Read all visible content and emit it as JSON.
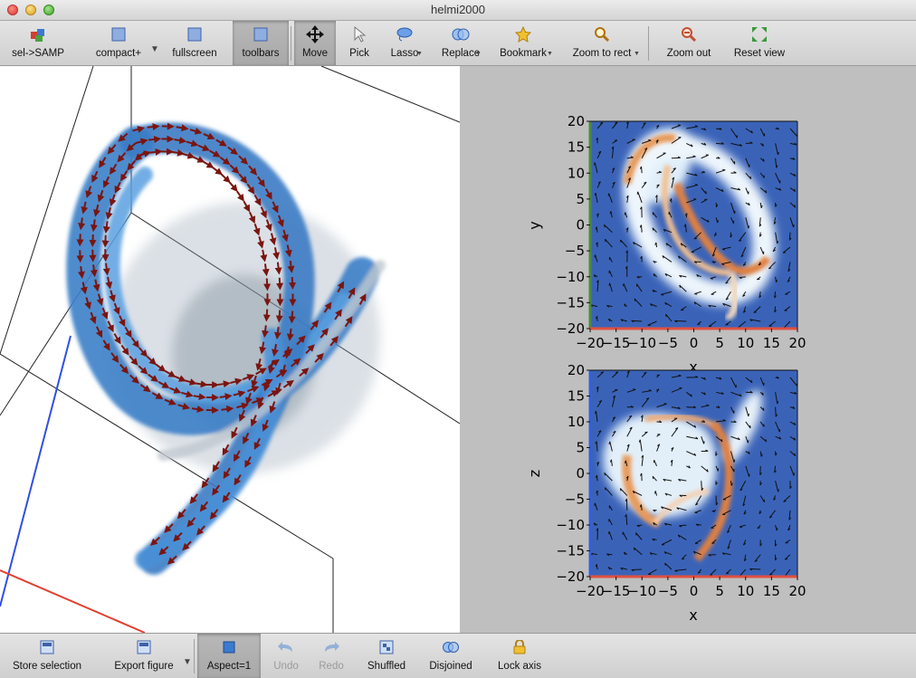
{
  "window": {
    "title": "helmi2000"
  },
  "toolbar": {
    "items": [
      {
        "label": "sel->SAMP"
      },
      {
        "label": "compact+"
      },
      {
        "label": "fullscreen"
      },
      {
        "label": "toolbars"
      },
      {
        "label": "Move"
      },
      {
        "label": "Pick"
      },
      {
        "label": "Lasso"
      },
      {
        "label": "Replace"
      },
      {
        "label": "Bookmark"
      },
      {
        "label": "Zoom to rect"
      },
      {
        "label": "Zoom out"
      },
      {
        "label": "Reset view"
      }
    ]
  },
  "bottombar": {
    "items": [
      {
        "label": "Store selection"
      },
      {
        "label": "Export figure"
      },
      {
        "label": "Aspect=1"
      },
      {
        "label": "Undo"
      },
      {
        "label": "Redo"
      },
      {
        "label": "Shuffled"
      },
      {
        "label": "Disjoined"
      },
      {
        "label": "Lock axis"
      }
    ]
  },
  "plots": {
    "top": {
      "xlabel": "x",
      "ylabel": "y",
      "xticks": [
        "−20",
        "−15",
        "−10",
        "−5",
        "0",
        "5",
        "10",
        "15",
        "20"
      ],
      "yticks": [
        "20",
        "15",
        "10",
        "5",
        "0",
        "−5",
        "−10",
        "−15",
        "−20"
      ]
    },
    "bottom": {
      "xlabel": "x",
      "ylabel": "z",
      "xticks": [
        "−20",
        "−15",
        "−10",
        "−5",
        "0",
        "5",
        "10",
        "15",
        "20"
      ],
      "yticks": [
        "20",
        "15",
        "10",
        "5",
        "0",
        "−5",
        "−10",
        "−15",
        "−20"
      ]
    }
  },
  "colors": {
    "background_plot": "#3a63b8",
    "density_hot": "#e0824a",
    "axis_x": "#e05040",
    "axis_y": "#4a8a3a",
    "axis_z": "#3060e0"
  }
}
